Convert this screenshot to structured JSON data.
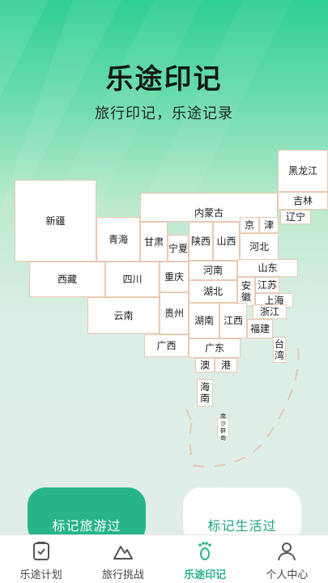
{
  "header": {
    "title": "乐途印记",
    "subtitle": "旅行印记，乐途记录"
  },
  "map": {
    "provinces": {
      "heilongjiang": "黑龙江",
      "jilin": "吉林",
      "liaoning": "辽宁",
      "xinjiang": "新疆",
      "neimenggu": "内蒙古",
      "beijing": "京",
      "tianjin": "津",
      "qinghai": "青海",
      "gansu": "甘肃",
      "ningxia": "宁夏",
      "shaanxi": "陕西",
      "shanxi": "山西",
      "hebei": "河北",
      "shandong": "山东",
      "henan": "河南",
      "xizang": "西藏",
      "sichuan": "四川",
      "chongqing": "重庆",
      "hubei": "湖北",
      "anhui": "安徽",
      "jiangsu": "江苏",
      "shanghai": "上海",
      "zhejiang": "浙江",
      "yunnan": "云南",
      "guizhou": "贵州",
      "hunan": "湖南",
      "jiangxi": "江西",
      "fujian": "福建",
      "taiwan": "台湾",
      "guangxi": "广西",
      "guangdong": "广东",
      "aomen": "澳",
      "xianggang": "港",
      "hainan": "海南",
      "nanshaqundao": "南沙群岛"
    }
  },
  "actions": {
    "mark_travel": "标记旅游过",
    "mark_life": "标记生活过"
  },
  "tabbar": {
    "items": [
      {
        "label": "乐途计划",
        "icon": "plan-icon"
      },
      {
        "label": "旅行挑战",
        "icon": "mountain-icon"
      },
      {
        "label": "乐途印记",
        "icon": "footprint-icon"
      },
      {
        "label": "个人中心",
        "icon": "person-icon"
      }
    ],
    "active_color": "#2bb38b"
  }
}
